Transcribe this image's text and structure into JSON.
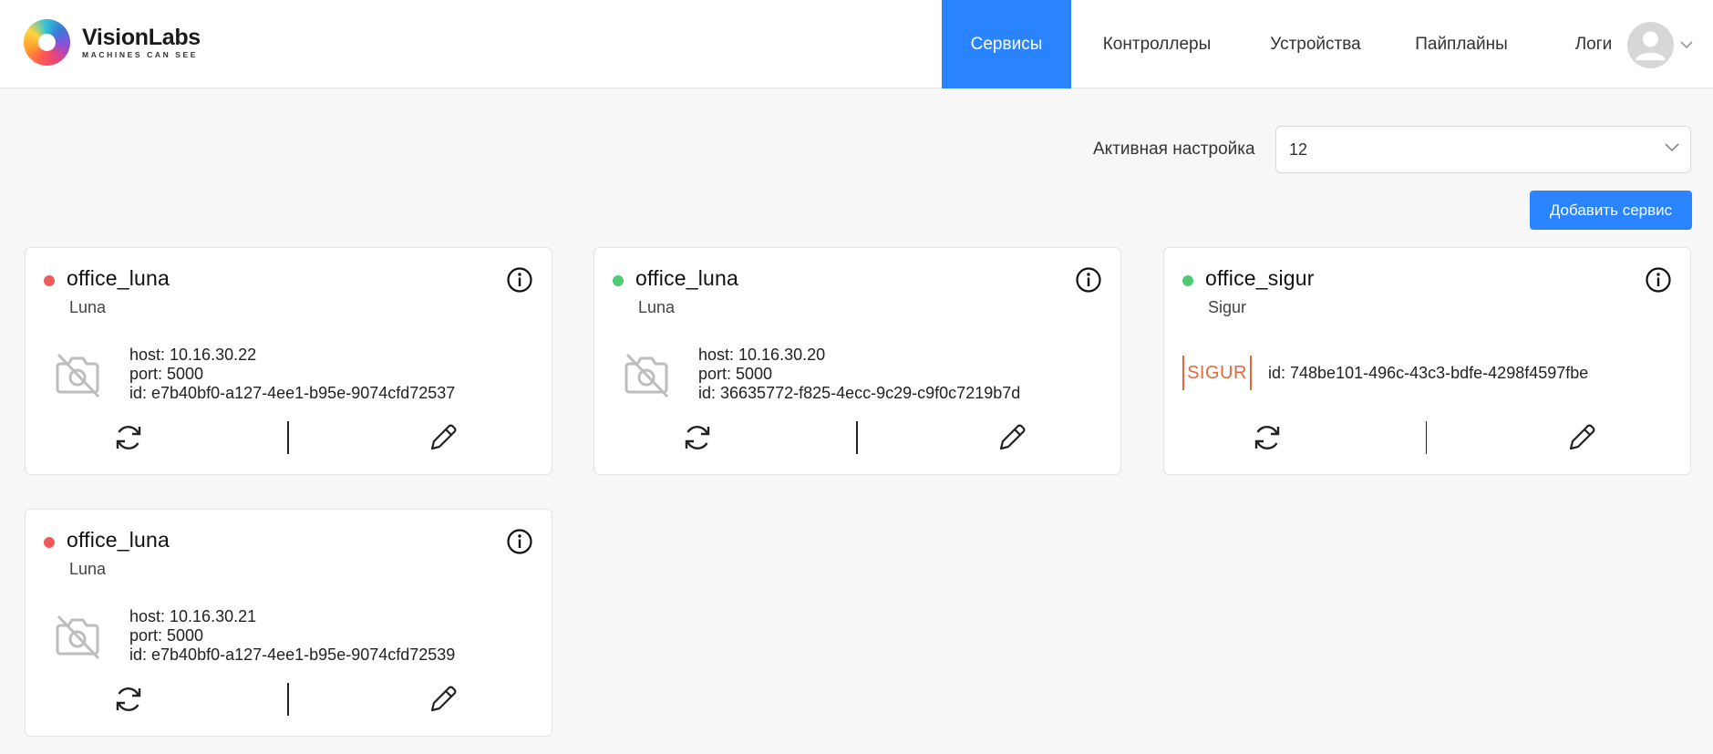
{
  "header": {
    "logo": {
      "name": "VisionLabs",
      "tagline": "MACHINES CAN SEE"
    },
    "nav": [
      {
        "label": "Сервисы",
        "active": true
      },
      {
        "label": "Контроллеры",
        "active": false
      },
      {
        "label": "Устройства",
        "active": false
      },
      {
        "label": "Пайплайны",
        "active": false
      },
      {
        "label": "Логи",
        "active": false
      }
    ]
  },
  "toolbar": {
    "setting_label": "Активная настройка",
    "setting_value": "12",
    "add_label": "Добавить сервис"
  },
  "colors": {
    "accent": "#2a84ff",
    "status_red": "#ef5b5b",
    "status_green": "#4ccb73",
    "sigur": "#e46a3c"
  },
  "services": [
    {
      "name": "office_luna",
      "type": "Luna",
      "status": "red",
      "host": "host: 10.16.30.22",
      "port": "port: 5000",
      "id": "id: e7b40bf0-a127-4ee1-b95e-9074cfd72537",
      "icon": "camera-off-icon"
    },
    {
      "name": "office_luna",
      "type": "Luna",
      "status": "green",
      "host": "host: 10.16.30.20",
      "port": "port: 5000",
      "id": "id: 36635772-f825-4ecc-9c29-c9f0c7219b7d",
      "icon": "camera-off-icon"
    },
    {
      "name": "office_sigur",
      "type": "Sigur",
      "status": "green",
      "logo_text": "SIGUR",
      "id": "id: 748be101-496c-43c3-bdfe-4298f4597fbe",
      "icon": "sigur-logo"
    },
    {
      "name": "office_luna",
      "type": "Luna",
      "status": "red",
      "host": "host: 10.16.30.21",
      "port": "port: 5000",
      "id": "id: e7b40bf0-a127-4ee1-b95e-9074cfd72539",
      "icon": "camera-off-icon"
    }
  ]
}
